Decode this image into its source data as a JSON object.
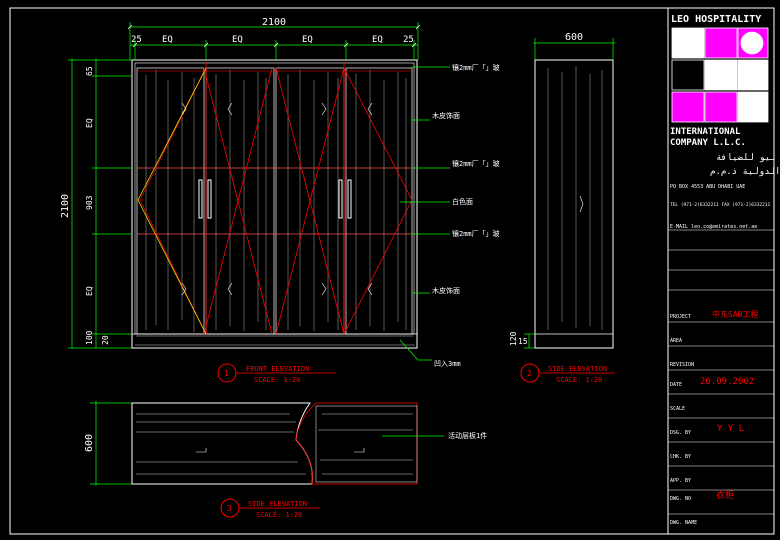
{
  "front": {
    "overall_width": "2100",
    "overall_height": "2100",
    "width_segments": [
      "25",
      "EQ",
      "EQ",
      "EQ",
      "EQ",
      "25"
    ],
    "height_segments": [
      "65",
      "EQ",
      "903",
      "EQ",
      "100",
      "20"
    ],
    "callouts": [
      "镶2mm厂「」玻",
      "木皮饰面",
      "镶2mm厂「」玻",
      "白色面",
      "镶2mm厂「」玻",
      "木皮饰面",
      "凹入3mm"
    ],
    "number": "1",
    "title": "FRONT ELEVATION",
    "scale": "SCALE: 1:20"
  },
  "side": {
    "width_dim": "600",
    "dim_120": "120",
    "dim_15": "15",
    "number": "2",
    "title": "SIDE ELEVATION",
    "scale": "SCALE: 1:20"
  },
  "side2": {
    "height_dim": "600",
    "callout": "活动层板1件",
    "number": "3",
    "title": "SIDE ELEVATION",
    "scale": "SCALE: 1:20"
  },
  "titleblock": {
    "company1": "LEO HOSPITALITY",
    "company2": "INTERNATIONAL",
    "company3": "COMPANY L.L.C.",
    "arabic": "ليو للضيافة",
    "arabic2": "الدولية ذ.م.م",
    "pobox": "PO BOX 4553   ABU DHABI UAE",
    "tel": "TEL (971-2)6332211  FAX (971-2)6332211",
    "email": "E-MAIL  leo.co@emirates.net.ae",
    "project_label": "PROJECT",
    "project_value": "中东SAB工程",
    "area_label": "AREA",
    "revision_label": "REVISION",
    "date_label": "DATE",
    "date_value": "26.09.2002",
    "scale_label": "SCALE",
    "dsg_label": "DSG. BY",
    "dsg_value": "Y Y L",
    "chk_label": "CHK. BY",
    "app_label": "APP. BY",
    "dwg_no_label": "DWG. NO",
    "dwg_no_value": "衣柜",
    "dwg_name_label": "DWG. NAME"
  },
  "colors": {
    "background": "#000000",
    "line": "#ffffff",
    "accent_red": "#ff0000",
    "dim_green": "#00ff00",
    "magenta": "#ff00ff",
    "yellow": "#ffff00"
  }
}
